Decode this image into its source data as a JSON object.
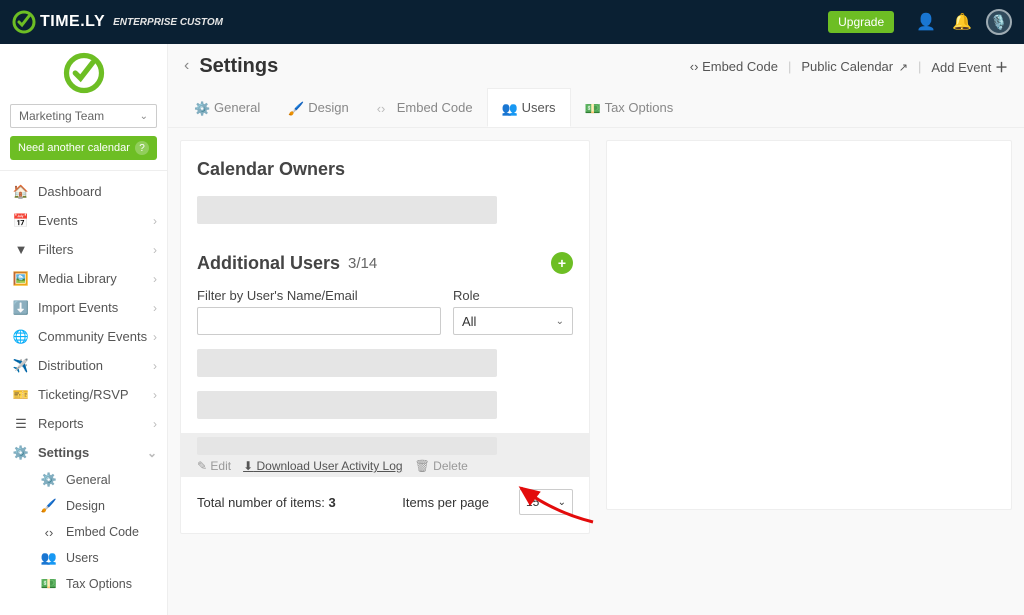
{
  "topbar": {
    "brand": "TIME.LY",
    "brand_sub": "ENTERPRISE CUSTOM",
    "upgrade": "Upgrade"
  },
  "sidebar": {
    "team": "Marketing Team",
    "need": "Need another calendar",
    "items": [
      {
        "icon": "home",
        "label": "Dashboard"
      },
      {
        "icon": "calendar",
        "label": "Events",
        "chev": true
      },
      {
        "icon": "filter",
        "label": "Filters",
        "chev": true
      },
      {
        "icon": "image",
        "label": "Media Library",
        "chev": true
      },
      {
        "icon": "download",
        "label": "Import Events",
        "chev": true
      },
      {
        "icon": "globe",
        "label": "Community Events",
        "chev": true
      },
      {
        "icon": "send",
        "label": "Distribution",
        "chev": true
      },
      {
        "icon": "ticket",
        "label": "Ticketing/RSVP",
        "chev": true
      },
      {
        "icon": "list",
        "label": "Reports",
        "chev": true
      },
      {
        "icon": "cogs",
        "label": "Settings",
        "chev": true,
        "active": true
      }
    ],
    "sub": [
      {
        "icon": "cogs",
        "label": "General"
      },
      {
        "icon": "brush",
        "label": "Design"
      },
      {
        "icon": "code",
        "label": "Embed Code"
      },
      {
        "icon": "users",
        "label": "Users"
      },
      {
        "icon": "money",
        "label": "Tax Options"
      }
    ]
  },
  "header": {
    "title": "Settings",
    "actions": {
      "embed": "Embed Code",
      "pub": "Public Calendar",
      "add": "Add Event"
    }
  },
  "tabs": [
    {
      "icon": "cogs",
      "label": "General"
    },
    {
      "icon": "brush",
      "label": "Design"
    },
    {
      "icon": "code",
      "label": "Embed Code"
    },
    {
      "icon": "users",
      "label": "Users",
      "active": true
    },
    {
      "icon": "money",
      "label": "Tax Options"
    }
  ],
  "panel": {
    "owners": "Calendar Owners",
    "additional": "Additional Users",
    "count": "3/14",
    "filter_label": "Filter by User's Name/Email",
    "role_label": "Role",
    "role_value": "All",
    "edit": "Edit",
    "download": "Download User Activity Log",
    "delete": "Delete",
    "total_label": "Total number of items: ",
    "total_value": "3",
    "ipp_label": "Items per page",
    "ipp_value": "15"
  }
}
